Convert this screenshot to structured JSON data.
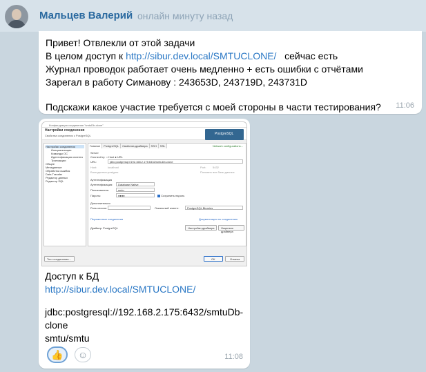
{
  "header": {
    "name": "Мальцев Валерий",
    "status": "онлайн минуту назад"
  },
  "message1": {
    "line1": "Привет! Отвлекли от этой задачи",
    "line2_prefix": "В целом доступ к",
    "line2_link": "http://sibur.dev.local/SMTUCLONE/",
    "line2_suffix": "сейчас есть",
    "line3": "Журнал проводок работает очень медленно + есть ошибки с отчётами",
    "line4": "Зарегал в работу Симанову : 243653D, 243719D, 243731D",
    "line5": "Подскажи какое участие требуется с моей стороны в части тестирования?",
    "time": "11:06"
  },
  "screenshot": {
    "window_title": "Конфигурация соединения \"smtuDb-clone\"",
    "header_title": "Настройки соединения",
    "header_sub": "Свойства соединения с PostgreSQL",
    "logo": "PostgreSQL",
    "tree": [
      "Настройки соединения",
      "Инициализация",
      "Команды ОС",
      "Идентификация клиента",
      "Транзакции",
      "Общее",
      "Метаданные",
      "Обработка ошибок",
      "Data Transfer",
      "Редактор данных",
      "Редактор SQL"
    ],
    "tabs": [
      "Главное",
      "PostgreSQL",
      "Свойства драйвера",
      "SSH",
      "SSL"
    ],
    "network_config": "Network configurations...",
    "server_label": "Server",
    "connect_by": "Connect by:",
    "host_opt": "Host",
    "url_opt": "URL",
    "url_label": "URL:",
    "url_value": "jdbc:postgresql://192.168.2.175:6432/smtuDb-clone",
    "host_label": "Host:",
    "host_value": "localhost",
    "port_label": "Port:",
    "port_value": "5432",
    "db_label": "База данных:",
    "db_value": "postgres",
    "show_all_db": "Показать все базы данных",
    "auth_label": "Аутентификация",
    "auth_type_label": "Аутентификация:",
    "auth_type_value": "Database Native",
    "user_label": "Пользователь:",
    "user_value": "smtu",
    "pass_label": "Пароль:",
    "pass_value": "●●●●",
    "save_pass": "Сохранить пароль",
    "extra_label": "Дополнительно",
    "role_label": "Роль сессии:",
    "local_client_label": "Локальный клиент:",
    "local_client_value": "PostgreSQL Binaries",
    "vars_link": "Переменные соединения",
    "driver_settings_link": "Документация по соединению",
    "driver_label": "Драйвер:",
    "driver_value": "PostgreSQL",
    "driver_btn": "Настройки драйвера",
    "license_btn": "Лицензия драйвера",
    "test_btn": "Тест соединения...",
    "ok_btn": "ОК",
    "cancel_btn": "Отмена"
  },
  "message2": {
    "line1": "Доступ к БД",
    "link": "http://sibur.dev.local/SMTUCLONE/",
    "jdbc": "jdbc:postgresql://192.168.2.175:6432/smtuDb-",
    "jdbc2": "clone",
    "creds": "smtu/smtu",
    "reaction": "👍",
    "add_reaction": "☺",
    "time": "11:08"
  }
}
